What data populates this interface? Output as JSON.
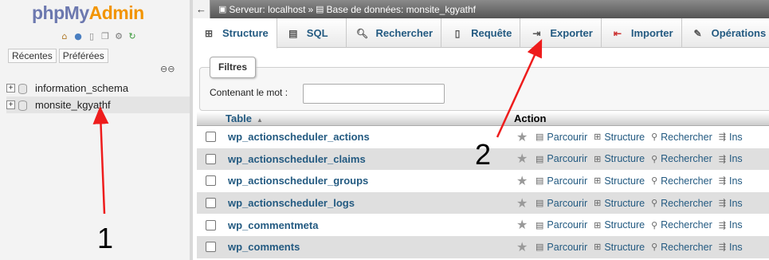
{
  "logo": {
    "php": "php",
    "my": "My",
    "admin": "Admin"
  },
  "nav": {
    "icons": [
      "home-icon",
      "logout-icon",
      "docs-icon",
      "copy-icon",
      "gear-icon",
      "reload-icon"
    ],
    "tabs": [
      "Récentes",
      "Préférées"
    ],
    "databases": [
      {
        "name": "information_schema",
        "selected": false
      },
      {
        "name": "monsite_kgyathf",
        "selected": true
      }
    ]
  },
  "breadcrumb": {
    "server_label": "Serveur: localhost",
    "separator": "»",
    "database_label": "Base de données: monsite_kgyathf"
  },
  "menu": [
    {
      "label": "Structure",
      "icon": "structure-icon",
      "active": true
    },
    {
      "label": "SQL",
      "icon": "sql-icon",
      "active": false
    },
    {
      "label": "Rechercher",
      "icon": "search-icon",
      "active": false
    },
    {
      "label": "Requête",
      "icon": "query-icon",
      "active": false
    },
    {
      "label": "Exporter",
      "icon": "export-icon",
      "active": false
    },
    {
      "label": "Importer",
      "icon": "import-icon",
      "active": false
    },
    {
      "label": "Opérations",
      "icon": "wrench-icon",
      "active": false
    }
  ],
  "filters": {
    "legend": "Filtres",
    "label": "Contenant le mot :",
    "value": ""
  },
  "table_list": {
    "headers": {
      "table": "Table",
      "action": "Action"
    },
    "actions": [
      "Parcourir",
      "Structure",
      "Rechercher",
      "Ins"
    ],
    "rows": [
      "wp_actionscheduler_actions",
      "wp_actionscheduler_claims",
      "wp_actionscheduler_groups",
      "wp_actionscheduler_logs",
      "wp_commentmeta",
      "wp_comments"
    ]
  },
  "annotations": {
    "one": "1",
    "two": "2"
  },
  "colors": {
    "arrow": "#ee1c1c",
    "link": "#235a81",
    "logo_php": "#6c78af",
    "logo_admin": "#f29400"
  }
}
